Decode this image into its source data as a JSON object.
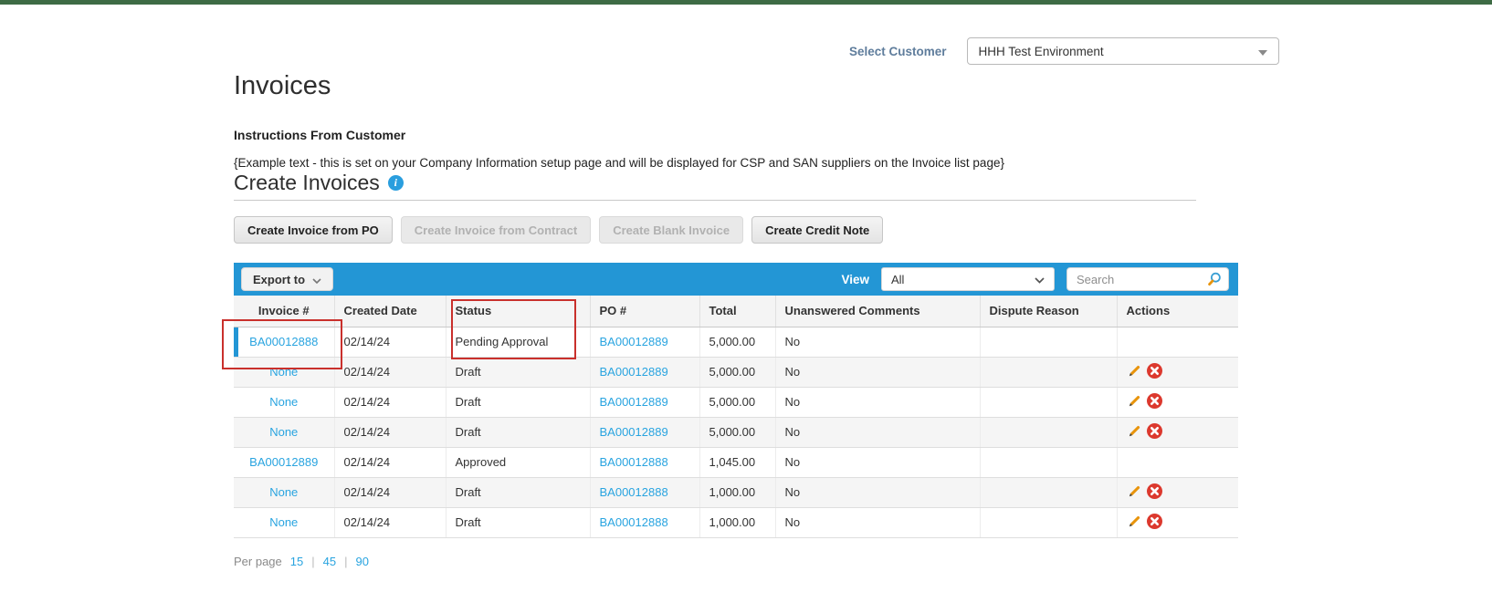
{
  "header": {
    "select_customer_label": "Select Customer",
    "customer_value": "HHH Test Environment"
  },
  "page": {
    "title": "Invoices",
    "instructions_heading": "Instructions From Customer",
    "instructions_text": "{Example text - this is set on your Company Information setup page and will be displayed for CSP and SAN suppliers on the Invoice list page}",
    "section_heading": "Create Invoices",
    "info_icon_glyph": "i"
  },
  "action_buttons": [
    {
      "label": "Create Invoice from PO",
      "enabled": true
    },
    {
      "label": "Create Invoice from Contract",
      "enabled": false
    },
    {
      "label": "Create Blank Invoice",
      "enabled": false
    },
    {
      "label": "Create Credit Note",
      "enabled": true
    }
  ],
  "toolbar": {
    "export_label": "Export to",
    "view_label": "View",
    "view_selected": "All",
    "search_placeholder": "Search"
  },
  "table": {
    "columns": [
      "Invoice #",
      "Created Date",
      "Status",
      "PO #",
      "Total",
      "Unanswered Comments",
      "Dispute Reason",
      "Actions"
    ],
    "rows": [
      {
        "invoice_number": "BA00012888",
        "created_date": "02/14/24",
        "status": "Pending Approval",
        "po_number": "BA00012889",
        "total": "5,000.00",
        "unanswered_comments": "No",
        "dispute_reason": "",
        "has_actions": false,
        "selected": true
      },
      {
        "invoice_number": "None",
        "created_date": "02/14/24",
        "status": "Draft",
        "po_number": "BA00012889",
        "total": "5,000.00",
        "unanswered_comments": "No",
        "dispute_reason": "",
        "has_actions": true,
        "selected": false
      },
      {
        "invoice_number": "None",
        "created_date": "02/14/24",
        "status": "Draft",
        "po_number": "BA00012889",
        "total": "5,000.00",
        "unanswered_comments": "No",
        "dispute_reason": "",
        "has_actions": true,
        "selected": false
      },
      {
        "invoice_number": "None",
        "created_date": "02/14/24",
        "status": "Draft",
        "po_number": "BA00012889",
        "total": "5,000.00",
        "unanswered_comments": "No",
        "dispute_reason": "",
        "has_actions": true,
        "selected": false
      },
      {
        "invoice_number": "BA00012889",
        "created_date": "02/14/24",
        "status": "Approved",
        "po_number": "BA00012888",
        "total": "1,045.00",
        "unanswered_comments": "No",
        "dispute_reason": "",
        "has_actions": false,
        "selected": false
      },
      {
        "invoice_number": "None",
        "created_date": "02/14/24",
        "status": "Draft",
        "po_number": "BA00012888",
        "total": "1,000.00",
        "unanswered_comments": "No",
        "dispute_reason": "",
        "has_actions": true,
        "selected": false
      },
      {
        "invoice_number": "None",
        "created_date": "02/14/24",
        "status": "Draft",
        "po_number": "BA00012888",
        "total": "1,000.00",
        "unanswered_comments": "No",
        "dispute_reason": "",
        "has_actions": true,
        "selected": false
      }
    ]
  },
  "pagination": {
    "label": "Per page",
    "options": [
      "15",
      "45",
      "90"
    ],
    "separator": "|"
  },
  "colors": {
    "top_bar_green": "#3e6b45",
    "toolbar_blue": "#2396d5",
    "link_blue": "#29a4e0",
    "label_blue_gray": "#5f7d9c",
    "annotation_red": "#c9302c",
    "delete_red": "#dc392e",
    "pencil_orange": "#e8940c"
  }
}
